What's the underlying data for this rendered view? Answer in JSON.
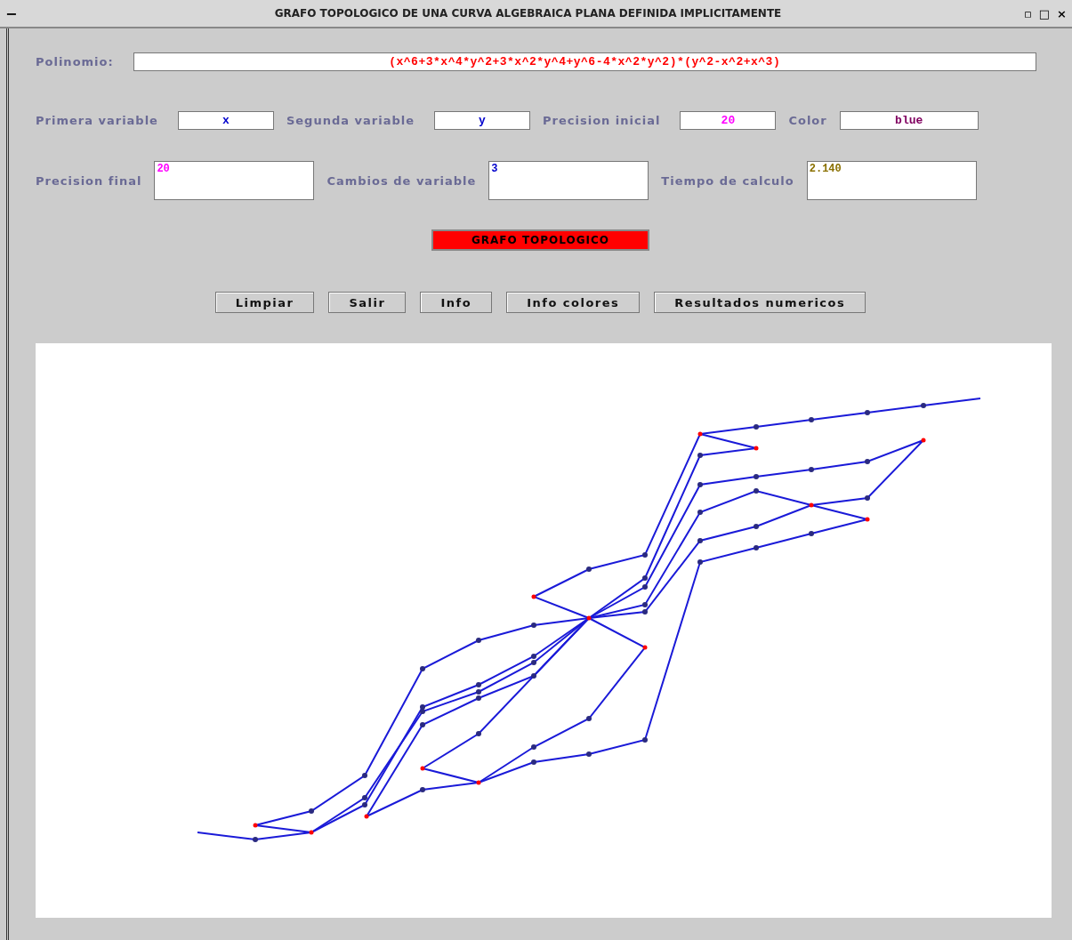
{
  "window": {
    "menu_glyph": "−",
    "title": "GRAFO TOPOLOGICO DE UNA CURVA ALGEBRAICA PLANA DEFINIDA IMPLICITAMENTE",
    "controls": [
      "▫",
      "□",
      "×"
    ]
  },
  "polynomial": {
    "label": "Polinomio:",
    "value": "(x^6+3*x^4*y^2+3*x^2*y^4+y^6-4*x^2*y^2)*(y^2-x^2+x^3)",
    "color": "#ff0000"
  },
  "fields_row1": [
    {
      "label": "Primera variable",
      "value": "x",
      "color": "#0000cc"
    },
    {
      "label": "Segunda variable",
      "value": "y",
      "color": "#0000cc"
    },
    {
      "label": "Precision inicial",
      "value": "20",
      "color": "#ff00ff"
    },
    {
      "label": "Color",
      "value": "blue",
      "color": "#800060"
    }
  ],
  "fields_row2": [
    {
      "label": "Precision final",
      "value": "20",
      "color": "#ff00ff"
    },
    {
      "label": "Cambios de variable",
      "value": "3",
      "color": "#0000cc"
    },
    {
      "label": "Tiempo de calculo",
      "value": "2.140",
      "color": "#8a7000"
    }
  ],
  "compute_button": "GRAFO TOPOLOGICO",
  "buttons": [
    "Limpiar",
    "Salir",
    "Info",
    "Info colores",
    "Resultados numericos"
  ]
}
